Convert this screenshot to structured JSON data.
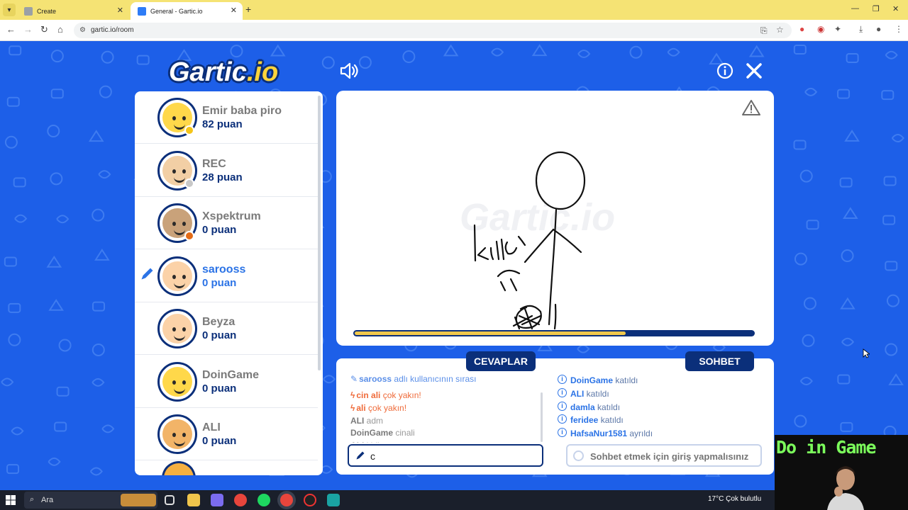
{
  "browser": {
    "tabs": [
      {
        "title": "Create",
        "active": false
      },
      {
        "title": "General - Gartic.io",
        "active": true
      }
    ],
    "url": "gartic.io/room"
  },
  "game": {
    "logo_main": "Gartic",
    "logo_suffix": ".io",
    "watermark": "Gartic.io",
    "timer_fraction": 0.68,
    "players": [
      {
        "name": "Emir baba piro",
        "points": "82 puan",
        "status_color": "#f5c518",
        "skin": "#ffd84a",
        "active": false
      },
      {
        "name": "REC",
        "points": "28 puan",
        "status_color": "#c8c8c8",
        "skin": "#f2cfa5",
        "active": false
      },
      {
        "name": "Xspektrum",
        "points": "0 puan",
        "status_color": "#e46b16",
        "skin": "#c9a27a",
        "active": false
      },
      {
        "name": "sarooss",
        "points": "0 puan",
        "status_color": null,
        "skin": "#fbd2a8",
        "active": true
      },
      {
        "name": "Beyza",
        "points": "0 puan",
        "status_color": null,
        "skin": "#fbd2a8",
        "active": false
      },
      {
        "name": "DoinGame",
        "points": "0 puan",
        "status_color": null,
        "skin": "#ffd84a",
        "active": false
      },
      {
        "name": "ALI",
        "points": "0 puan",
        "status_color": null,
        "skin": "#f2b468",
        "active": false
      }
    ],
    "answers": {
      "label": "CEVAPLAR",
      "messages": [
        {
          "kind": "turn",
          "user": "sarooss",
          "text": "adlı kullanıcının sırası"
        },
        {
          "kind": "close",
          "user": "cin ali",
          "text": "çok yakın!"
        },
        {
          "kind": "close",
          "user": "ali",
          "text": "çok yakın!"
        },
        {
          "kind": "guess",
          "user": "ALI",
          "text": "adm"
        },
        {
          "kind": "guess",
          "user": "DoinGame",
          "text": "cinali"
        },
        {
          "kind": "guess",
          "user": "ALI",
          "text": "kirik"
        }
      ],
      "input_value": "c"
    },
    "chat": {
      "label": "SOHBET",
      "messages": [
        {
          "user": "DoinGame",
          "text": "katıldı"
        },
        {
          "user": "ALI",
          "text": "katıldı"
        },
        {
          "user": "damla",
          "text": "katıldı"
        },
        {
          "user": "feridee",
          "text": "katıldı"
        },
        {
          "user": "HafsaNur1581",
          "text": "ayrıldı"
        }
      ],
      "placeholder": "Sohbet etmek için giriş yapmalısınız"
    }
  },
  "stream_overlay": {
    "title": "Do in Game"
  },
  "taskbar": {
    "search_placeholder": "Ara",
    "weather": "17°C  Çok bulutlu"
  },
  "colors": {
    "page_bg": "#1d5fe8",
    "navy": "#0b2f7a",
    "accent_blue": "#2b73e6",
    "close_orange": "#ef6b3a",
    "timer_yellow": "#f1c84b"
  }
}
